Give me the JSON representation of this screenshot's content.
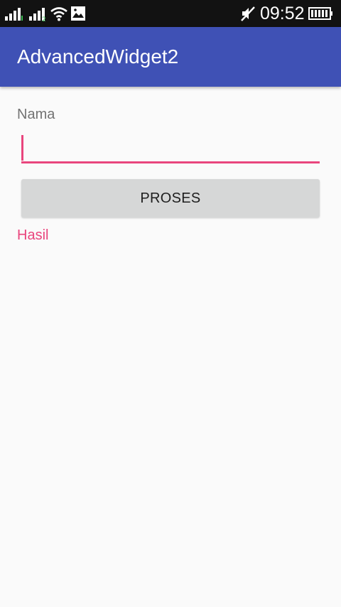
{
  "status_bar": {
    "time": "09:52",
    "icons": [
      "signal-icon",
      "signal-2-icon",
      "wifi-icon",
      "image-icon",
      "mute-icon",
      "battery-icon"
    ]
  },
  "app_bar": {
    "title": "AdvancedWidget2"
  },
  "form": {
    "name_label": "Nama",
    "name_value": "",
    "button_label": "PROSES",
    "result_text": "Hasil"
  },
  "colors": {
    "app_bar": "#3f51b5",
    "accent": "#e9457d",
    "status_bar": "#121212",
    "background": "#fafafa",
    "button": "#d6d7d7"
  }
}
